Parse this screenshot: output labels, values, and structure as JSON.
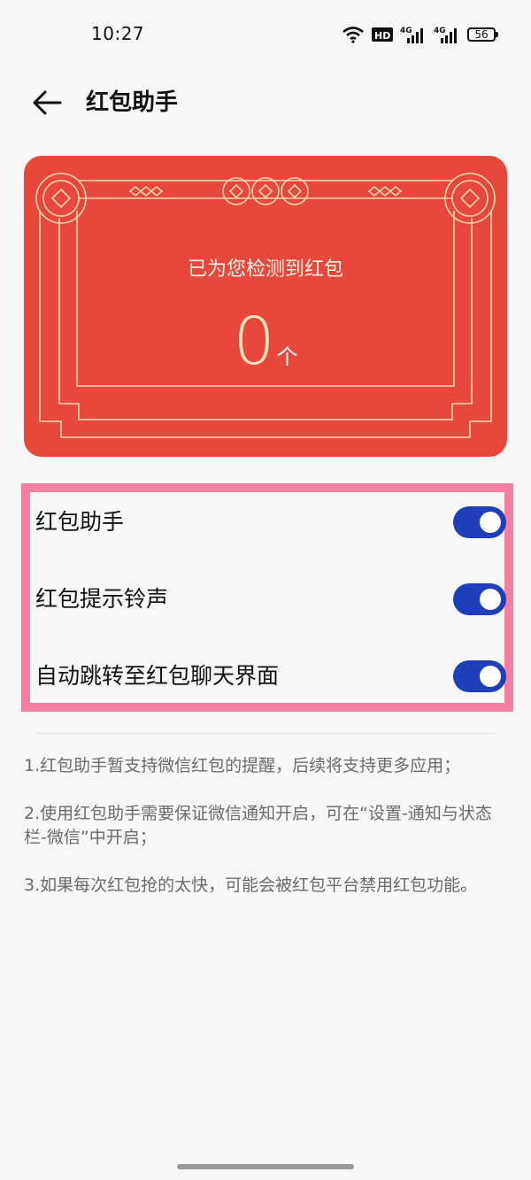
{
  "status_bar": {
    "time": "10:27",
    "battery": "56",
    "hd_label": "HD",
    "net_label_1": "4G",
    "net_label_2": "4G"
  },
  "header": {
    "back_icon": "arrow-left-icon",
    "title": "红包助手"
  },
  "summary_card": {
    "subtitle": "已为您检测到红包",
    "count": "0",
    "unit": "个",
    "colors": {
      "background": "#e8483c",
      "ornament": "#f6d7b0"
    }
  },
  "settings": [
    {
      "label": "红包助手",
      "enabled": true
    },
    {
      "label": "红包提示铃声",
      "enabled": true
    },
    {
      "label": "自动跳转至红包聊天界面",
      "enabled": true
    }
  ],
  "notes": [
    "1.红包助手暂支持微信红包的提醒，后续将支持更多应用；",
    "2.使用红包助手需要保证微信通知开启，可在“设置-通知与状态栏-微信”中开启；",
    "3.如果每次红包抢的太快，可能会被红包平台禁用红包功能。"
  ],
  "colors": {
    "toggle_on": "#1f3fba",
    "highlight_border": "#f47fa0"
  }
}
